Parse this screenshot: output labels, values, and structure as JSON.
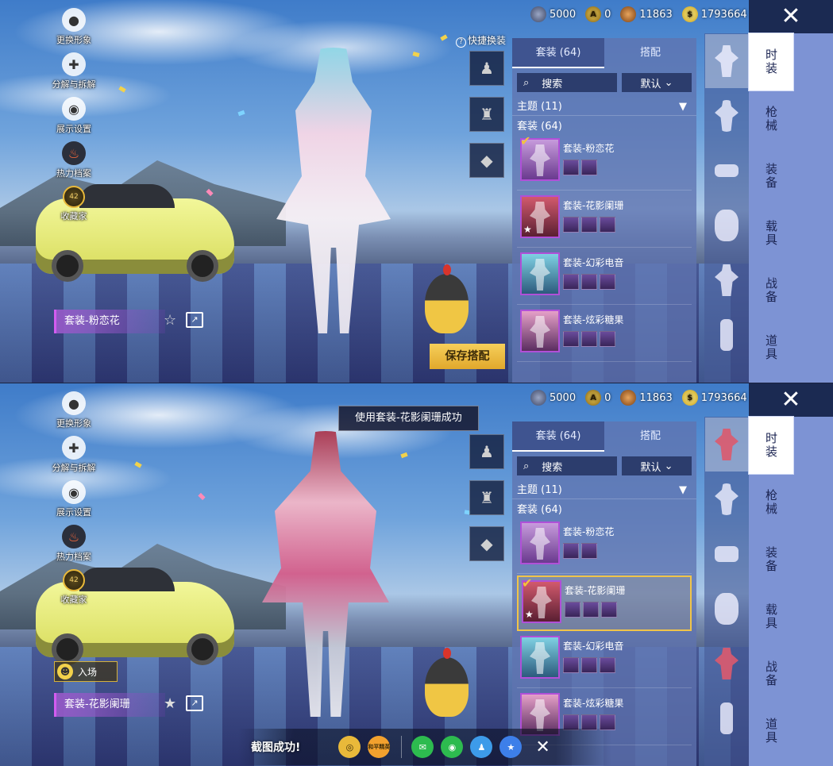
{
  "currency": [
    {
      "icon": "silver-coin-icon",
      "value": "5000"
    },
    {
      "icon": "gold-badge-icon",
      "value": "0"
    },
    {
      "icon": "bronze-coin-icon",
      "value": "11863"
    },
    {
      "icon": "bp-coin-icon",
      "value": "1793664"
    }
  ],
  "left_menu": [
    {
      "label": "更换形象",
      "icon": "avatar-icon"
    },
    {
      "label": "分解与拆解",
      "icon": "puzzle-icon"
    },
    {
      "label": "展示设置",
      "icon": "eye-icon"
    },
    {
      "label": "热力档案",
      "icon": "flame-icon"
    },
    {
      "label": "收藏家",
      "icon": "collector-badge-icon",
      "level": "42"
    }
  ],
  "quick_swap": "快捷换装",
  "save_button": "保存搭配",
  "tabs": [
    {
      "label": "套装 (64)"
    },
    {
      "label": "搭配"
    }
  ],
  "search": {
    "label": "搜索",
    "sort": "默认"
  },
  "theme_filter": "主题 (11)",
  "subheader": "套装 (64)",
  "items": [
    {
      "name": "套装-粉恋花"
    },
    {
      "name": "套装-花影阑珊"
    },
    {
      "name": "套装-幻彩电音"
    },
    {
      "name": "套装-炫彩糖果"
    }
  ],
  "nav": [
    {
      "label": "时装"
    },
    {
      "label": "枪械"
    },
    {
      "label": "装备"
    },
    {
      "label": "载具"
    },
    {
      "label": "战备"
    },
    {
      "label": "道具"
    }
  ],
  "top": {
    "outfit_label": "套装-粉恋花"
  },
  "bottom": {
    "toast": "使用套装-花影阑珊成功",
    "outfit_label": "套装-花影阑珊",
    "entry_button": "入场",
    "screenshot_text": "截图成功!",
    "share_icons": [
      {
        "icon": "game-share-icon",
        "color": "#e9b93a"
      },
      {
        "icon": "peace-elite-icon",
        "color": "#f2a12e",
        "text": "和平精英"
      },
      {
        "icon": "wechat-icon",
        "color": "#2dbb4f"
      },
      {
        "icon": "moments-icon",
        "color": "#2dbb4f"
      },
      {
        "icon": "qq-icon",
        "color": "#3d9be9"
      },
      {
        "icon": "qzone-star-icon",
        "color": "#3d7fe9"
      }
    ]
  }
}
